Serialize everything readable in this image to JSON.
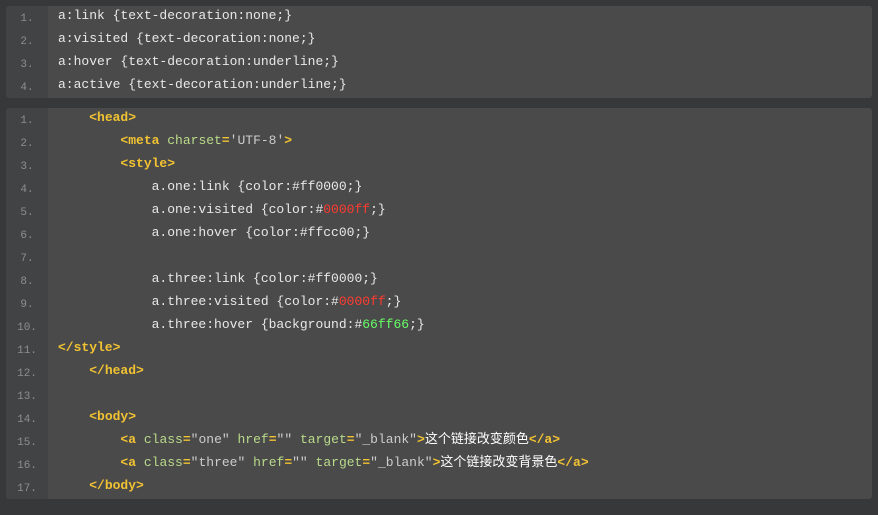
{
  "block1": {
    "lines": [
      {
        "n": "1.",
        "tokens": [
          {
            "c": "plain",
            "t": "a:link {text-decoration:none;}"
          }
        ]
      },
      {
        "n": "2.",
        "tokens": [
          {
            "c": "plain",
            "t": "a:visited {text-decoration:none;}"
          }
        ]
      },
      {
        "n": "3.",
        "tokens": [
          {
            "c": "plain",
            "t": "a:hover {text-decoration:underline;}"
          }
        ]
      },
      {
        "n": "4.",
        "tokens": [
          {
            "c": "plain",
            "t": "a:active {text-decoration:underline;}"
          }
        ]
      }
    ]
  },
  "block2": {
    "lines": [
      {
        "n": "1.",
        "tokens": [
          {
            "c": "plain",
            "t": "    "
          },
          {
            "c": "tag",
            "t": "<head>"
          }
        ]
      },
      {
        "n": "2.",
        "tokens": [
          {
            "c": "plain",
            "t": "        "
          },
          {
            "c": "tag",
            "t": "<meta"
          },
          {
            "c": "plain",
            "t": " "
          },
          {
            "c": "attr",
            "t": "charset"
          },
          {
            "c": "tag",
            "t": "="
          },
          {
            "c": "str",
            "t": "'UTF-8'"
          },
          {
            "c": "tag",
            "t": ">"
          }
        ]
      },
      {
        "n": "3.",
        "tokens": [
          {
            "c": "plain",
            "t": "        "
          },
          {
            "c": "tag",
            "t": "<style>"
          }
        ]
      },
      {
        "n": "4.",
        "tokens": [
          {
            "c": "plain",
            "t": "            a.one:link {color:#ff0000;}"
          }
        ]
      },
      {
        "n": "5.",
        "tokens": [
          {
            "c": "plain",
            "t": "            a.one:visited {color:#"
          },
          {
            "c": "red",
            "t": "0000ff"
          },
          {
            "c": "plain",
            "t": ";}"
          }
        ]
      },
      {
        "n": "6.",
        "tokens": [
          {
            "c": "plain",
            "t": "            a.one:hover {color:#ffcc00;}"
          }
        ]
      },
      {
        "n": "7.",
        "tokens": []
      },
      {
        "n": "8.",
        "tokens": [
          {
            "c": "plain",
            "t": "            a.three:link {color:#ff0000;}"
          }
        ]
      },
      {
        "n": "9.",
        "tokens": [
          {
            "c": "plain",
            "t": "            a.three:visited {color:#"
          },
          {
            "c": "red",
            "t": "0000ff"
          },
          {
            "c": "plain",
            "t": ";}"
          }
        ]
      },
      {
        "n": "10.",
        "tokens": [
          {
            "c": "plain",
            "t": "            a.three:hover {background:#"
          },
          {
            "c": "grn",
            "t": "66ff66"
          },
          {
            "c": "plain",
            "t": ";}"
          }
        ]
      },
      {
        "n": "11.",
        "tokens": [
          {
            "c": "tag",
            "t": "</style>"
          }
        ]
      },
      {
        "n": "12.",
        "tokens": [
          {
            "c": "plain",
            "t": "    "
          },
          {
            "c": "tag",
            "t": "</head>"
          }
        ]
      },
      {
        "n": "13.",
        "tokens": []
      },
      {
        "n": "14.",
        "tokens": [
          {
            "c": "plain",
            "t": "    "
          },
          {
            "c": "tag",
            "t": "<body>"
          }
        ]
      },
      {
        "n": "15.",
        "tokens": [
          {
            "c": "plain",
            "t": "        "
          },
          {
            "c": "tag",
            "t": "<a"
          },
          {
            "c": "plain",
            "t": " "
          },
          {
            "c": "attr",
            "t": "class"
          },
          {
            "c": "tag",
            "t": "="
          },
          {
            "c": "str",
            "t": "\"one\""
          },
          {
            "c": "plain",
            "t": " "
          },
          {
            "c": "attr",
            "t": "href"
          },
          {
            "c": "tag",
            "t": "="
          },
          {
            "c": "str",
            "t": "\"\""
          },
          {
            "c": "plain",
            "t": " "
          },
          {
            "c": "attr",
            "t": "target"
          },
          {
            "c": "tag",
            "t": "="
          },
          {
            "c": "str",
            "t": "\"_blank\""
          },
          {
            "c": "tag",
            "t": ">"
          },
          {
            "c": "txt",
            "t": "这个链接改变颜色"
          },
          {
            "c": "tag",
            "t": "</a>"
          }
        ]
      },
      {
        "n": "16.",
        "tokens": [
          {
            "c": "plain",
            "t": "        "
          },
          {
            "c": "tag",
            "t": "<a"
          },
          {
            "c": "plain",
            "t": " "
          },
          {
            "c": "attr",
            "t": "class"
          },
          {
            "c": "tag",
            "t": "="
          },
          {
            "c": "str",
            "t": "\"three\""
          },
          {
            "c": "plain",
            "t": " "
          },
          {
            "c": "attr",
            "t": "href"
          },
          {
            "c": "tag",
            "t": "="
          },
          {
            "c": "str",
            "t": "\"\""
          },
          {
            "c": "plain",
            "t": " "
          },
          {
            "c": "attr",
            "t": "target"
          },
          {
            "c": "tag",
            "t": "="
          },
          {
            "c": "str",
            "t": "\"_blank\""
          },
          {
            "c": "tag",
            "t": ">"
          },
          {
            "c": "txt",
            "t": "这个链接改变背景色"
          },
          {
            "c": "tag",
            "t": "</a>"
          }
        ]
      },
      {
        "n": "17.",
        "tokens": [
          {
            "c": "plain",
            "t": "    "
          },
          {
            "c": "tag",
            "t": "</body>"
          }
        ]
      }
    ]
  }
}
